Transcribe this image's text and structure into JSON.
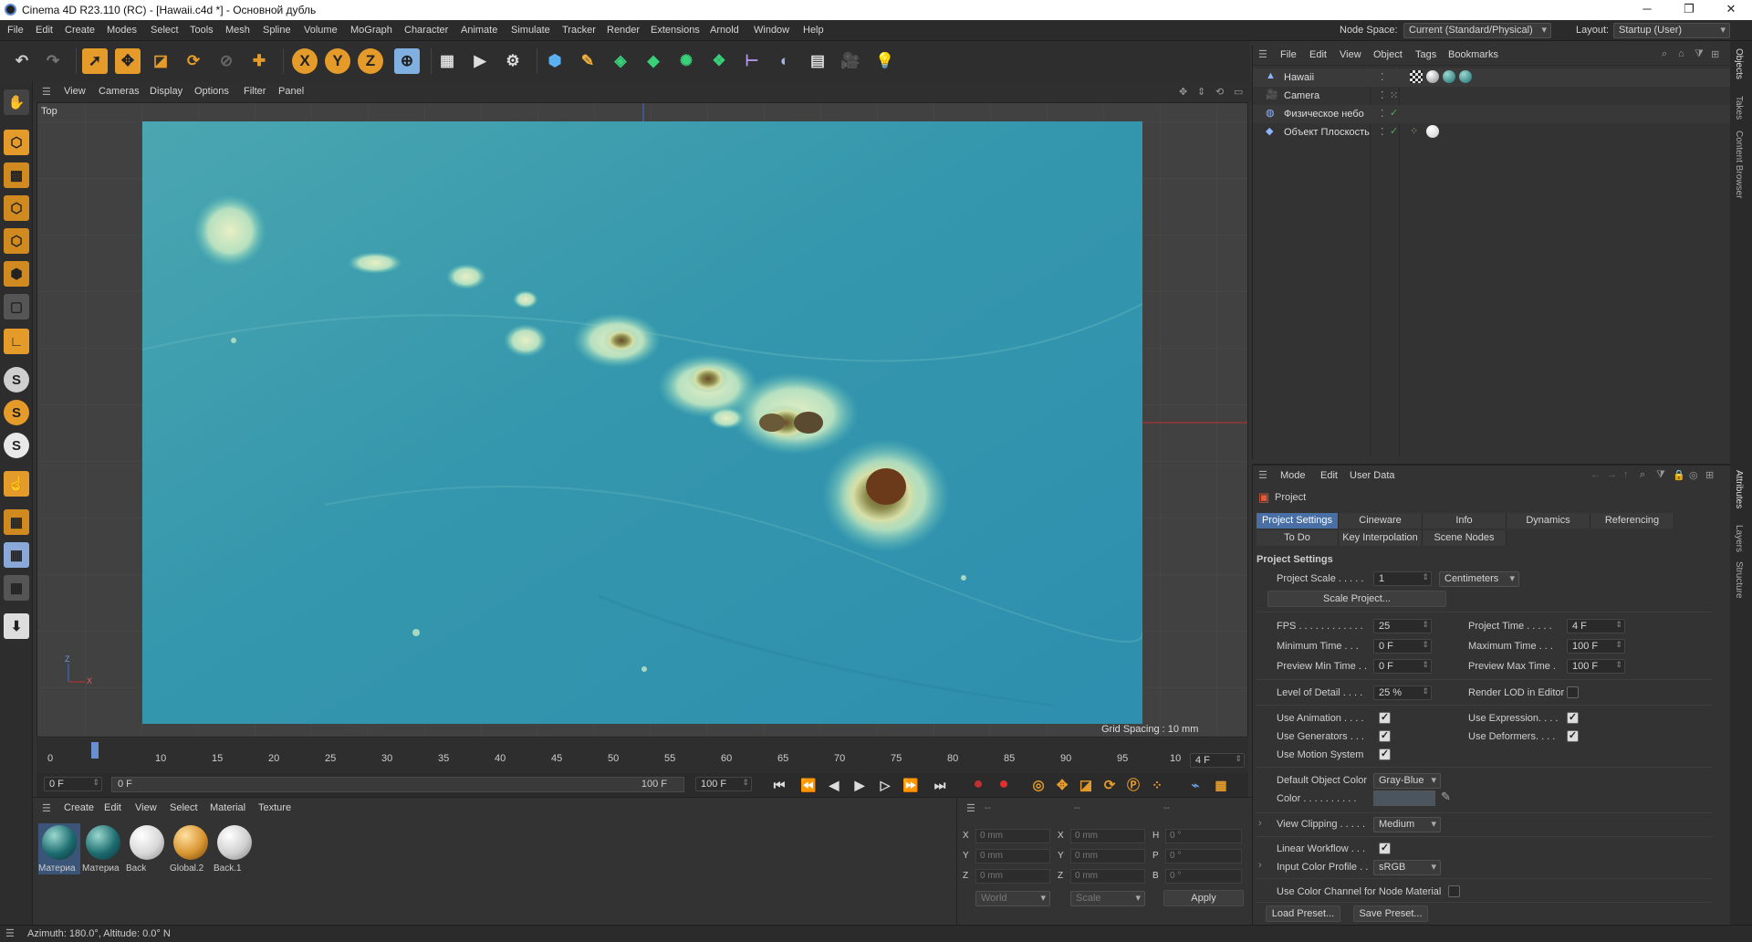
{
  "titlebar": {
    "title": "Cinema 4D R23.110 (RC) - [Hawaii.c4d *] - Основной дубль",
    "minimize": "─",
    "maximize": "❐",
    "close": "✕"
  },
  "menubar": {
    "items": [
      "File",
      "Edit",
      "Create",
      "Modes",
      "Select",
      "Tools",
      "Mesh",
      "Spline",
      "Volume",
      "MoGraph",
      "Character",
      "Animate",
      "Simulate",
      "Tracker",
      "Render",
      "Extensions",
      "Arnold",
      "Window",
      "Help"
    ],
    "node_space_label": "Node Space:",
    "node_space_value": "Current (Standard/Physical)",
    "layout_label": "Layout:",
    "layout_value": "Startup (User)"
  },
  "toolbar": {
    "axis_x": "X",
    "axis_y": "Y",
    "axis_z": "Z"
  },
  "viewport": {
    "menu": [
      "View",
      "Cameras",
      "Display",
      "Options",
      "Filter",
      "Panel"
    ],
    "view_name": "Top",
    "grid_spacing": "Grid Spacing : 10 mm",
    "axis_z": "Z",
    "axis_x": "X"
  },
  "timeline": {
    "ticks": [
      "0",
      "10",
      "15",
      "20",
      "25",
      "30",
      "35",
      "40",
      "45",
      "50",
      "55",
      "60",
      "65",
      "70",
      "75",
      "80",
      "85",
      "90",
      "95",
      "10"
    ],
    "current_frame_field": "4 F",
    "playhead_label": "4",
    "start_field": "0 F",
    "range_start": "0 F",
    "range_end": "100 F",
    "end_field": "100 F"
  },
  "material_manager": {
    "menu": [
      "Create",
      "Edit",
      "View",
      "Select",
      "Material",
      "Texture"
    ],
    "materials": [
      {
        "label": "Материа",
        "color": "teal-globe"
      },
      {
        "label": "Материа",
        "color": "teal-globe"
      },
      {
        "label": "Back",
        "color": "white"
      },
      {
        "label": "Global.2",
        "color": "orange"
      },
      {
        "label": "Back.1",
        "color": "white"
      }
    ]
  },
  "coordinates": {
    "headers": [
      "--",
      "--",
      "--"
    ],
    "rows": [
      {
        "a": "X",
        "av": "0 mm",
        "b": "X",
        "bv": "0 mm",
        "c": "H",
        "cv": "0 °"
      },
      {
        "a": "Y",
        "av": "0 mm",
        "b": "Y",
        "bv": "0 mm",
        "c": "P",
        "cv": "0 °"
      },
      {
        "a": "Z",
        "av": "0 mm",
        "b": "Z",
        "bv": "0 mm",
        "c": "B",
        "cv": "0 °"
      }
    ],
    "space": "World",
    "mode": "Scale",
    "apply": "Apply"
  },
  "statusbar": {
    "text": "Azimuth: 180.0°, Altitude: 0.0°  N"
  },
  "object_manager": {
    "menu": [
      "File",
      "Edit",
      "View",
      "Object",
      "Tags",
      "Bookmarks"
    ],
    "objects": [
      {
        "name": "Hawaii"
      },
      {
        "name": "Camera"
      },
      {
        "name": "Физическое небо"
      },
      {
        "name": "Объект Плоскость"
      }
    ]
  },
  "attribute_manager": {
    "menu": [
      "Mode",
      "Edit",
      "User Data"
    ],
    "object_label": "Project",
    "tabs_row1": [
      "Project Settings",
      "Cineware",
      "Info",
      "Dynamics",
      "Referencing"
    ],
    "tabs_row2": [
      "To Do",
      "Key Interpolation",
      "Scene Nodes"
    ],
    "section_title": "Project Settings",
    "project_scale_label": "Project Scale . . . . .",
    "project_scale_value": "1",
    "project_scale_unit": "Centimeters",
    "scale_project_button": "Scale Project...",
    "fps_label": "FPS . . . . . . . . . . . .",
    "fps_value": "25",
    "project_time_label": "Project Time . . . . .",
    "project_time_value": "4 F",
    "min_time_label": "Minimum Time . . .",
    "min_time_value": "0 F",
    "max_time_label": "Maximum Time . . .",
    "max_time_value": "100 F",
    "preview_min_label": "Preview Min Time . .",
    "preview_min_value": "0 F",
    "preview_max_label": "Preview Max Time .",
    "preview_max_value": "100 F",
    "lod_label": "Level of Detail . . . .",
    "lod_value": "25 %",
    "render_lod_label": "Render LOD in Editor",
    "use_animation_label": "Use Animation . . . .",
    "use_expression_label": "Use Expression. . . .",
    "use_generators_label": "Use Generators . . .",
    "use_deformers_label": "Use Deformers. . . .",
    "use_motion_label": "Use Motion System",
    "default_color_label": "Default Object Color",
    "default_color_value": "Gray-Blue",
    "color_label": "Color . . . . . . . . . .",
    "view_clipping_label": "View Clipping . . . . .",
    "view_clipping_value": "Medium",
    "linear_workflow_label": "Linear Workflow . . .",
    "input_profile_label": "Input Color Profile . .",
    "input_profile_value": "sRGB",
    "use_color_channel_label": "Use Color Channel for Node Material",
    "load_preset": "Load Preset...",
    "save_preset": "Save Preset..."
  },
  "right_tabs": [
    "Objects",
    "Takes",
    "Content Browser",
    "Attributes",
    "Layers",
    "Structure"
  ]
}
